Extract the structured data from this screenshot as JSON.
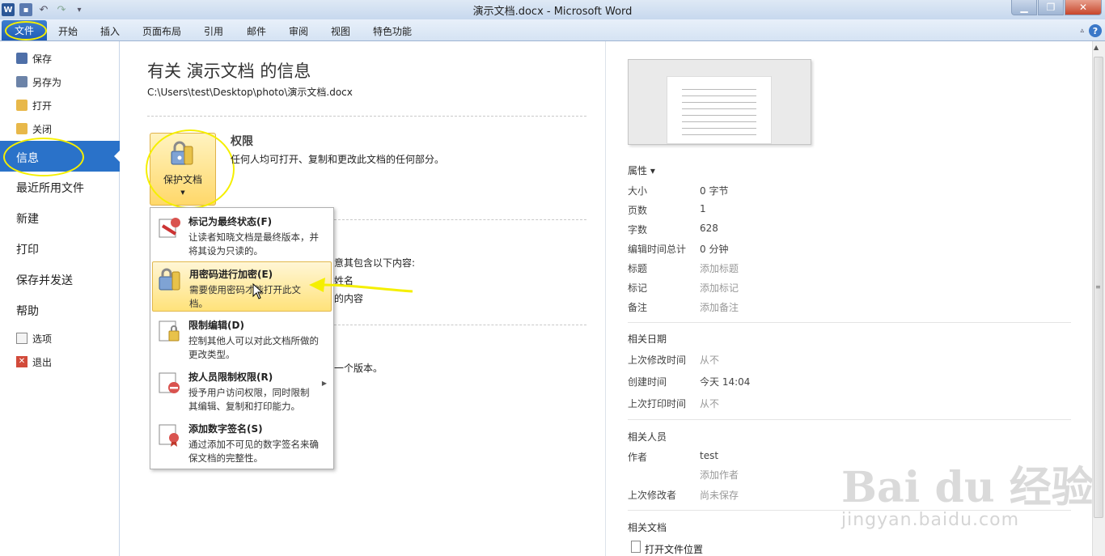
{
  "window": {
    "title": "演示文档.docx  -  Microsoft Word"
  },
  "ribbon": {
    "file_tab": "文件",
    "tabs": [
      "开始",
      "插入",
      "页面布局",
      "引用",
      "邮件",
      "审阅",
      "视图",
      "特色功能"
    ]
  },
  "nav": {
    "save": "保存",
    "save_as": "另存为",
    "open": "打开",
    "close": "关闭",
    "info": "信息",
    "recent": "最近所用文件",
    "new": "新建",
    "print": "打印",
    "save_send": "保存并发送",
    "help": "帮助",
    "options": "选项",
    "exit": "退出"
  },
  "info": {
    "heading": "有关 演示文档 的信息",
    "path": "C:\\Users\\test\\Desktop\\photo\\演示文档.docx",
    "protect_button": "保护文档",
    "permissions_title": "权限",
    "permissions_desc": "任何人均可打开、复制和更改此文档的任何部分。",
    "bg_line1": "意其包含以下内容:",
    "bg_line2": "姓名",
    "bg_line3": "的内容",
    "bg_line4": "一个版本。"
  },
  "protect_menu": [
    {
      "title": "标记为最终状态(F)",
      "desc": "让读者知晓文档是最终版本，并将其设为只读的。"
    },
    {
      "title": "用密码进行加密(E)",
      "desc": "需要使用密码才能打开此文档。"
    },
    {
      "title": "限制编辑(D)",
      "desc": "控制其他人可以对此文档所做的更改类型。"
    },
    {
      "title": "按人员限制权限(R)",
      "desc": "授予用户访问权限，同时限制其编辑、复制和打印能力。"
    },
    {
      "title": "添加数字签名(S)",
      "desc": "通过添加不可见的数字签名来确保文档的完整性。"
    }
  ],
  "properties": {
    "title": "属性 ▾",
    "rows": [
      {
        "label": "大小",
        "value": "0 字节"
      },
      {
        "label": "页数",
        "value": "1"
      },
      {
        "label": "字数",
        "value": "628"
      },
      {
        "label": "编辑时间总计",
        "value": "0 分钟"
      },
      {
        "label": "标题",
        "value": "添加标题"
      },
      {
        "label": "标记",
        "value": "添加标记"
      },
      {
        "label": "备注",
        "value": "添加备注"
      }
    ]
  },
  "dates": {
    "title": "相关日期",
    "rows": [
      {
        "label": "上次修改时间",
        "value": "从不"
      },
      {
        "label": "创建时间",
        "value": "今天 14:04"
      },
      {
        "label": "上次打印时间",
        "value": "从不"
      }
    ]
  },
  "people": {
    "title": "相关人员",
    "author_label": "作者",
    "author": "test",
    "add_author": "添加作者",
    "modifier_label": "上次修改者",
    "modifier": "尚未保存"
  },
  "docs": {
    "title": "相关文档",
    "open_location": "打开文件位置"
  },
  "watermark": {
    "logo": "Bai du 经验",
    "url": "jingyan.baidu.com"
  },
  "colors": {
    "accent": "#2a72c9",
    "highlight": "#f5ef00",
    "hover": "#ffe27a"
  }
}
